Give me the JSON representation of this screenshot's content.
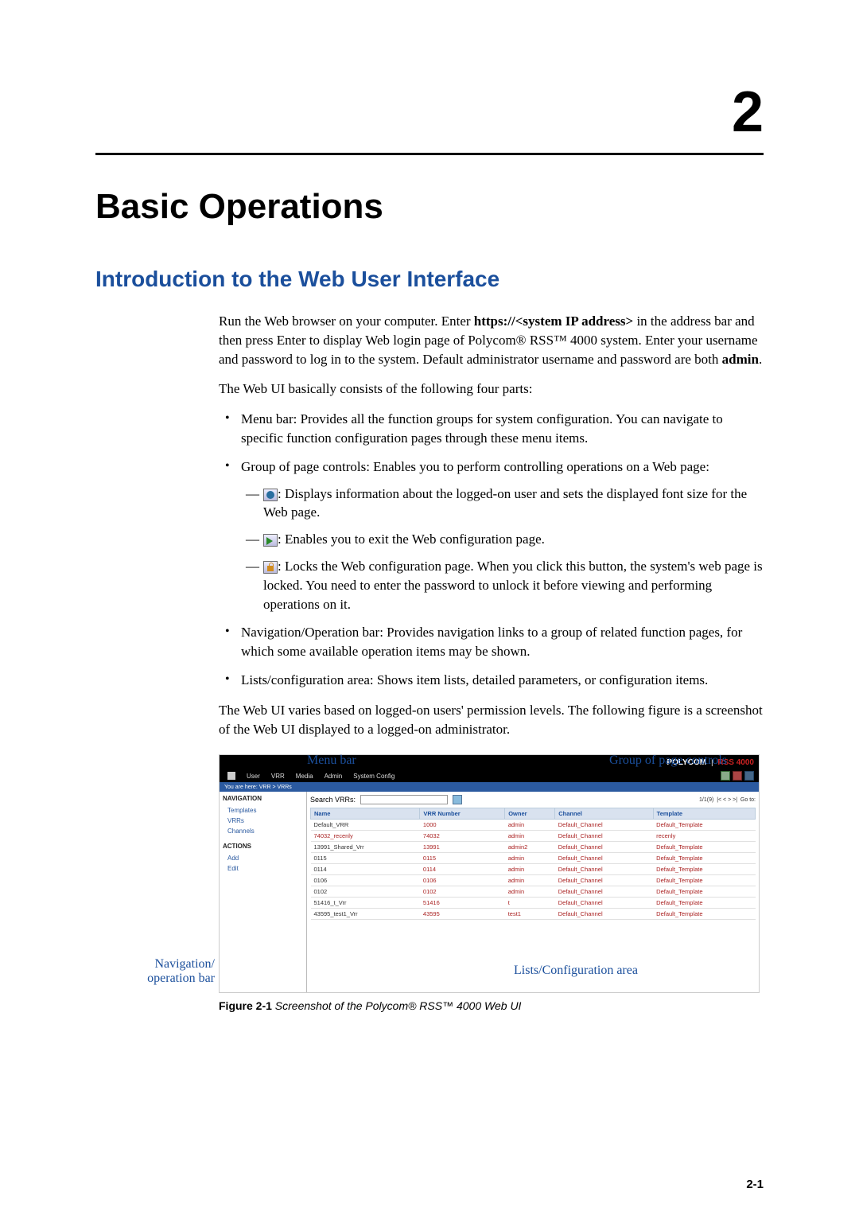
{
  "chapter_number": "2",
  "chapter_title": "Basic Operations",
  "section_title": "Introduction to the Web User Interface",
  "intro_para_1a": "Run the Web browser on your computer. Enter ",
  "intro_bold_url": "https://<system IP address>",
  "intro_para_1b": " in the address bar and then press Enter to display Web login page of Polycom® RSS™ 4000 system. Enter your username and password to log in to the system. Default administrator username and password are both ",
  "intro_bold_admin": "admin",
  "intro_para_1c": ".",
  "intro_para_2": "The Web UI basically consists of the following four parts:",
  "bullet1": "Menu bar: Provides all the function groups for system configuration. You can navigate to specific function configuration pages through these menu items.",
  "bullet2": "Group of page controls: Enables you to perform controlling operations on a Web page:",
  "sub1": ": Displays information about the logged-on user and sets the displayed font size for the Web page.",
  "sub2": ": Enables you to exit the Web configuration page.",
  "sub3": ": Locks the Web configuration page. When you click this button, the system's web page is locked. You need to enter the password to unlock it before viewing and performing operations on it.",
  "bullet3": "Navigation/Operation bar: Provides navigation links to a group of related function pages, for which some available operation items may be shown.",
  "bullet4": "Lists/configuration area: Shows item lists, detailed parameters, or configuration items.",
  "closing_para": "The Web UI varies based on logged-on users' permission levels. The following figure is a screenshot of the Web UI displayed to a logged-on administrator.",
  "figure": {
    "label": "Figure 2-1",
    "text": "Screenshot of the Polycom® RSS™ 4000 Web UI",
    "callouts": {
      "menu": "Menu bar",
      "group": "Group of page controls",
      "nav": "Navigation/ operation bar",
      "list": "Lists/Configuration area"
    },
    "ui": {
      "brand_poly": "POLYCOM",
      "brand_rss": "RSS 4000",
      "menu_items": [
        "User",
        "VRR",
        "Media",
        "Admin",
        "System Config"
      ],
      "breadcrumb": "You are here:  VRR  >  VRRs",
      "sidebar": {
        "nav_header": "NAVIGATION",
        "nav_items": [
          "Templates",
          "VRRs",
          "Channels"
        ],
        "actions_header": "ACTIONS",
        "actions_items": [
          "Add",
          "Edit"
        ]
      },
      "search_label": "Search VRRs:",
      "pager": "1/1(9)",
      "goto": "Go to:",
      "table": {
        "headers": [
          "Name",
          "VRR Number",
          "Owner",
          "Channel",
          "Template"
        ],
        "rows": [
          [
            "Default_VRR",
            "1000",
            "admin",
            "Default_Channel",
            "Default_Template"
          ],
          [
            "74032_recenly",
            "74032",
            "admin",
            "Default_Channel",
            "recenly"
          ],
          [
            "13991_Shared_Vrr",
            "13991",
            "admin2",
            "Default_Channel",
            "Default_Template"
          ],
          [
            "0115",
            "0115",
            "admin",
            "Default_Channel",
            "Default_Template"
          ],
          [
            "0114",
            "0114",
            "admin",
            "Default_Channel",
            "Default_Template"
          ],
          [
            "0106",
            "0106",
            "admin",
            "Default_Channel",
            "Default_Template"
          ],
          [
            "0102",
            "0102",
            "admin",
            "Default_Channel",
            "Default_Template"
          ],
          [
            "51416_t_Vrr",
            "51416",
            "t",
            "Default_Channel",
            "Default_Template"
          ],
          [
            "43595_test1_Vrr",
            "43595",
            "test1",
            "Default_Channel",
            "Default_Template"
          ]
        ]
      }
    }
  },
  "page_number": "2-1"
}
